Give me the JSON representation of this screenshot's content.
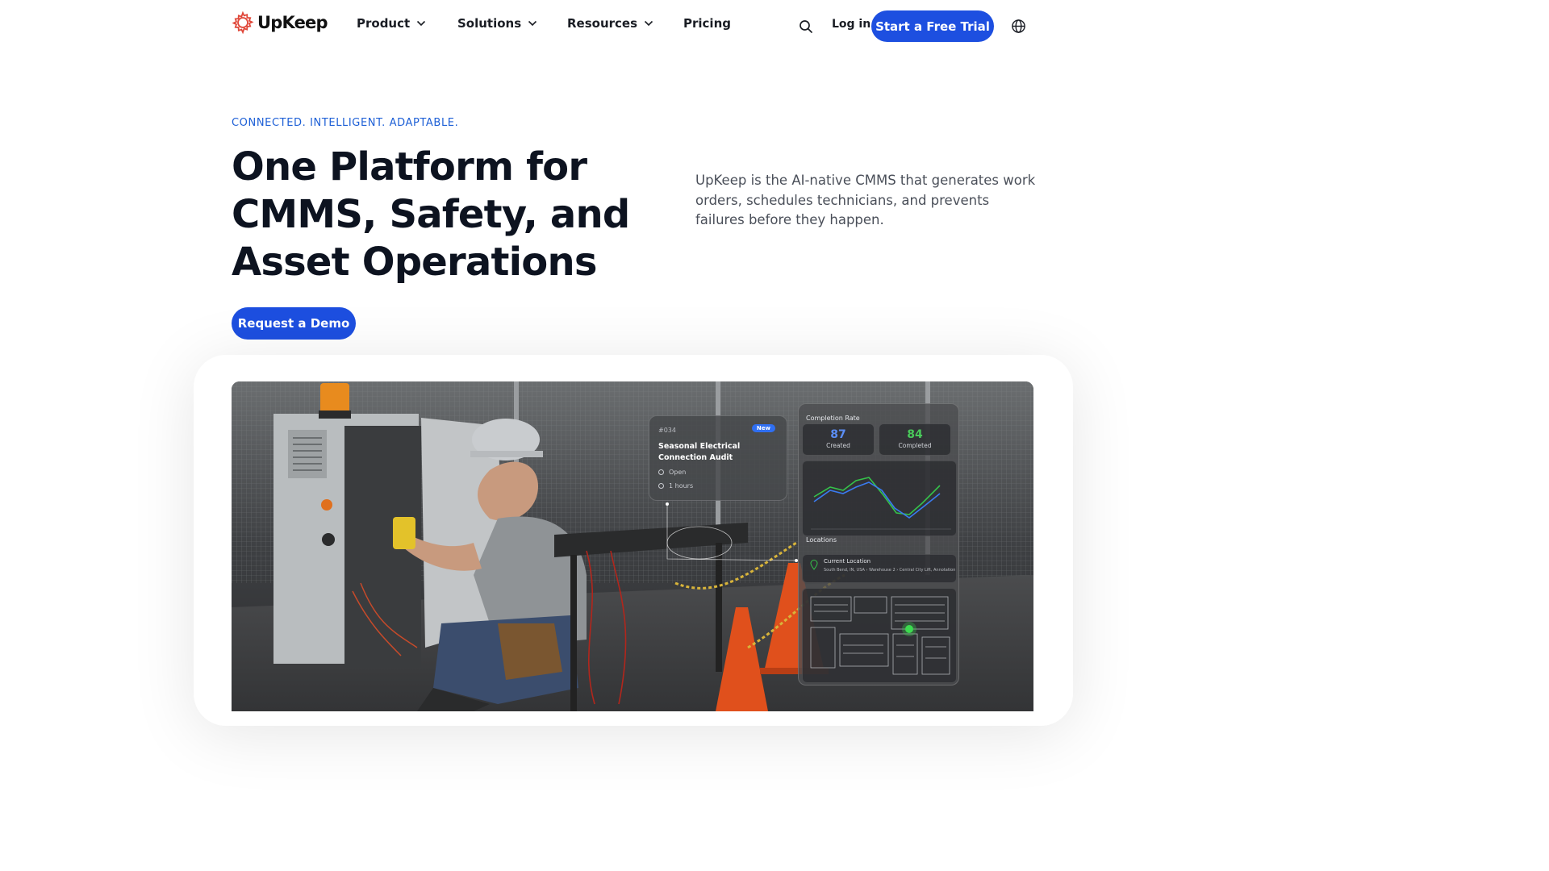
{
  "nav": {
    "logo_text": "UpKeep",
    "menu": [
      {
        "label": "Product"
      },
      {
        "label": "Solutions"
      },
      {
        "label": "Resources"
      },
      {
        "label": "Pricing"
      }
    ],
    "login_label": "Log in",
    "trial_label": "Start a Free Trial"
  },
  "hero": {
    "eyebrow": "CONNECTED. INTELLIGENT. ADAPTABLE.",
    "headline": "One Platform for CMMS, Safety, and Asset Operations",
    "subcopy": "UpKeep is the AI-native CMMS that generates work orders, schedules technicians, and prevents failures before they happen.",
    "demo_label": "Request a Demo"
  },
  "overlay": {
    "work_order": {
      "id": "#034",
      "badge": "New",
      "title": "Seasonal Electrical Connection Audit",
      "status": "Open",
      "duration": "1 hours"
    },
    "stats": {
      "title": "Completion Rate",
      "created_value": "87",
      "created_label": "Created",
      "completed_value": "84",
      "completed_label": "Completed"
    },
    "locations": {
      "title": "Locations",
      "current_title": "Current Location",
      "path": "South Bend, IN, USA  ›  Warehouse 2  ›  Central City Lift, Annotation"
    }
  },
  "colors": {
    "brand_blue": "#1d4fe0",
    "eyebrow_blue": "#1d5fd6",
    "logo_red": "#e0483a",
    "series_green": "#35c24a",
    "series_blue": "#3a7bf0"
  },
  "icons": [
    "upkeep-logo-icon",
    "chevron-down-icon",
    "search-icon",
    "globe-icon"
  ]
}
